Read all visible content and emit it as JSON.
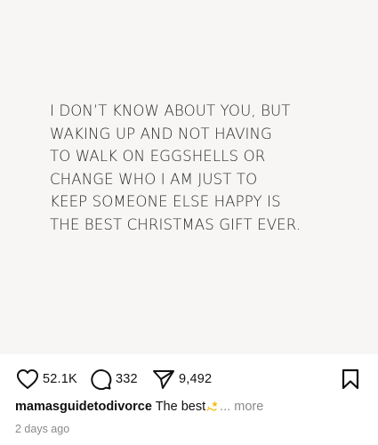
{
  "post": {
    "quote_text": "I DON’T KNOW ABOUT YOU, BUT\nWAKING UP AND NOT HAVING\nTO WALK ON EGGSHELLS OR\nCHANGE WHO I AM JUST TO\nKEEP SOMEONE ELSE HAPPY IS\nTHE BEST CHRISTMAS GIFT EVER."
  },
  "actions": {
    "likes": "52.1K",
    "comments": "332",
    "shares": "9,492",
    "like_icon": "heart-icon",
    "comment_icon": "comment-bubble-icon",
    "share_icon": "paper-plane-icon",
    "save_icon": "bookmark-icon"
  },
  "caption": {
    "username": "mamasguidetodivorce",
    "text": "The best",
    "emoji": "dizzy-star-emoji",
    "more_label": "... more"
  },
  "timestamp": "2 days ago",
  "colors": {
    "text": "#111111",
    "muted": "#8a8a8a",
    "image_background": "#f7f6f4",
    "emoji": "#f2c21b"
  }
}
